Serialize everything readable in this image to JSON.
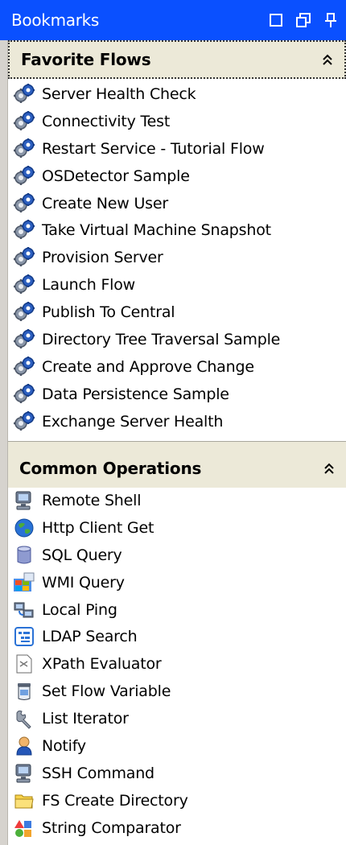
{
  "panel": {
    "title": "Bookmarks",
    "title_bar_color": "#0a50ff"
  },
  "favorite_flows": {
    "header": "Favorite Flows",
    "icon": "gear-flow-icon",
    "items": [
      {
        "label": "Server Health Check"
      },
      {
        "label": "Connectivity Test"
      },
      {
        "label": "Restart Service - Tutorial Flow"
      },
      {
        "label": "OSDetector Sample"
      },
      {
        "label": "Create New User"
      },
      {
        "label": "Take Virtual Machine Snapshot"
      },
      {
        "label": "Provision Server"
      },
      {
        "label": "Launch Flow"
      },
      {
        "label": "Publish To Central"
      },
      {
        "label": "Directory Tree Traversal Sample"
      },
      {
        "label": "Create and Approve Change"
      },
      {
        "label": "Data Persistence Sample"
      },
      {
        "label": "Exchange Server Health"
      }
    ]
  },
  "common_operations": {
    "header": "Common Operations",
    "items": [
      {
        "label": "Remote Shell",
        "icon": "remote-shell-icon"
      },
      {
        "label": "Http Client Get",
        "icon": "globe-icon"
      },
      {
        "label": "SQL Query",
        "icon": "database-icon"
      },
      {
        "label": "WMI Query",
        "icon": "windows-icon"
      },
      {
        "label": "Local Ping",
        "icon": "ping-icon"
      },
      {
        "label": "LDAP Search",
        "icon": "ldap-tree-icon"
      },
      {
        "label": "XPath Evaluator",
        "icon": "xpath-document-icon"
      },
      {
        "label": "Set Flow Variable",
        "icon": "jar-icon"
      },
      {
        "label": "List Iterator",
        "icon": "wrench-icon"
      },
      {
        "label": "Notify",
        "icon": "user-icon"
      },
      {
        "label": "SSH Command",
        "icon": "ssh-terminal-icon"
      },
      {
        "label": "FS Create Directory",
        "icon": "folder-icon"
      },
      {
        "label": "String Comparator",
        "icon": "shapes-icon"
      }
    ]
  }
}
